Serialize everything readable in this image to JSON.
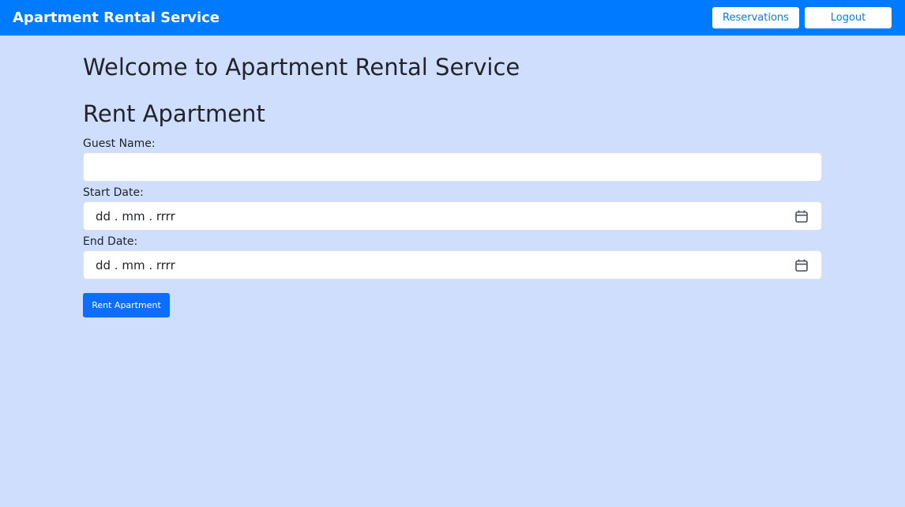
{
  "navbar": {
    "brand": "Apartment Rental Service",
    "reservations_label": "Reservations",
    "logout_label": "Logout",
    "background_color": "#007bff"
  },
  "main": {
    "welcome_heading": "Welcome to Apartment Rental Service",
    "form_heading": "Rent Apartment",
    "form": {
      "guest_name": {
        "label": "Guest Name:",
        "value": "",
        "placeholder": ""
      },
      "start_date": {
        "label": "Start Date:",
        "display": "dd . mm . rrrr",
        "icon": "calendar-icon"
      },
      "end_date": {
        "label": "End Date:",
        "display": "dd . mm . rrrr",
        "icon": "calendar-icon"
      },
      "submit_label": "Rent Apartment"
    }
  },
  "colors": {
    "page_background": "#cfdefc",
    "primary": "#0d6efd"
  }
}
